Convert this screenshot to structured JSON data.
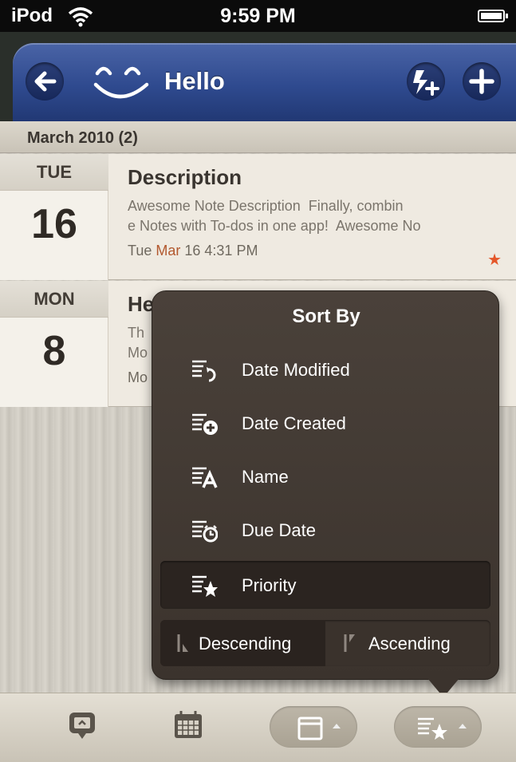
{
  "status_bar": {
    "carrier": "iPod",
    "time": "9:59 PM"
  },
  "nav": {
    "title": "Hello",
    "back_icon": "back-arrow-icon",
    "edit_icon": "lightning-plus-icon",
    "add_icon": "plus-icon"
  },
  "section": {
    "header": "March 2010 (2)"
  },
  "notes": [
    {
      "day": "TUE",
      "date": "16",
      "title": "Description",
      "snippet_1": "Awesome Note Description  Finally, combin",
      "snippet_2": "e Notes with To-dos in one app!  Awesome No",
      "meta_day": "Tue",
      "meta_month": "Mar",
      "meta_rest": "16  4:31 PM",
      "starred": true
    },
    {
      "day": "MON",
      "date": "8",
      "title": "He",
      "snippet_1": "Th",
      "snippet_2": "Mo",
      "meta_day": "Mo"
    }
  ],
  "popover": {
    "title": "Sort By",
    "options": [
      {
        "label": "Date Modified",
        "icon": "sort-date-modified-icon",
        "selected": false
      },
      {
        "label": "Date Created",
        "icon": "sort-date-created-icon",
        "selected": false
      },
      {
        "label": "Name",
        "icon": "sort-name-icon",
        "selected": false
      },
      {
        "label": "Due Date",
        "icon": "sort-due-date-icon",
        "selected": false
      },
      {
        "label": "Priority",
        "icon": "sort-priority-icon",
        "selected": true
      }
    ],
    "order": {
      "descending": "Descending",
      "ascending": "Ascending",
      "selected": "descending"
    }
  },
  "toolbar": {
    "icons": [
      "note-view-icon",
      "calendar-icon",
      "date-filter-icon",
      "sort-priority-icon"
    ]
  },
  "colors": {
    "nav_blue": "#2f4a8f",
    "popover_bg": "#3b332d",
    "accent_orange": "#e4572a",
    "date_red": "#b2582e"
  }
}
